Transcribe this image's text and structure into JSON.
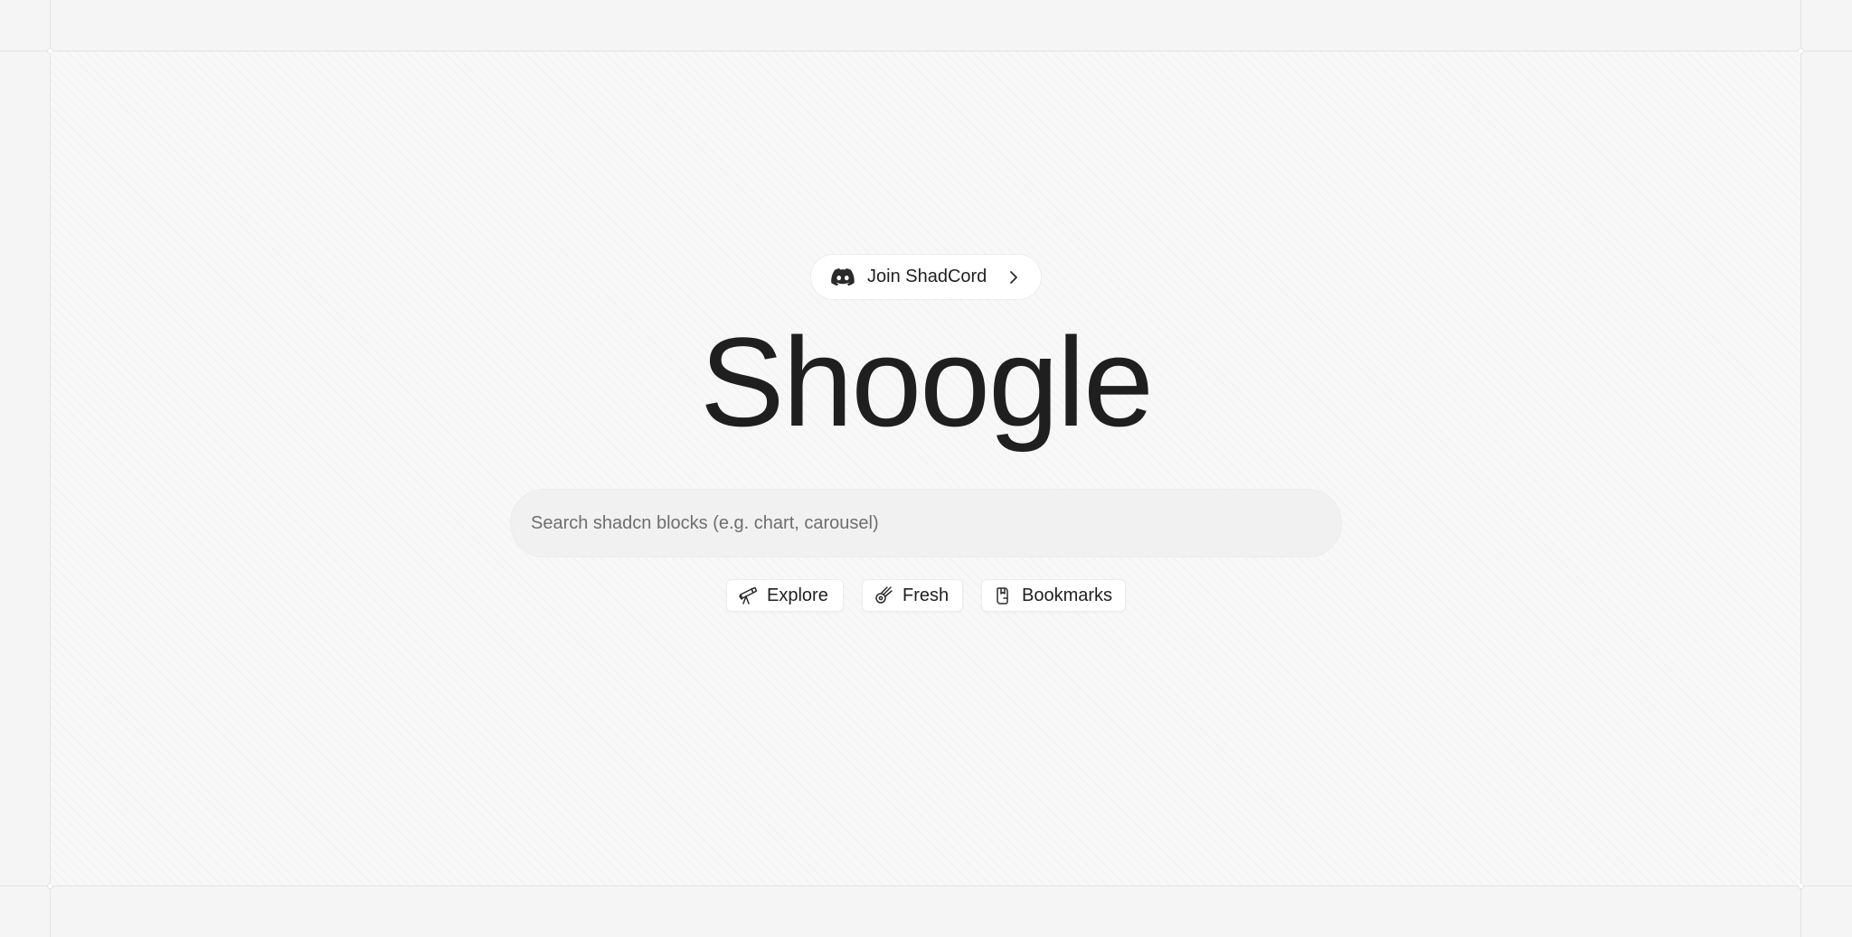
{
  "discord": {
    "label": "Join ShadCord",
    "icon": "discord-icon",
    "arrow_icon": "chevron-right-icon"
  },
  "brand": {
    "title": "Shoogle"
  },
  "search": {
    "placeholder": "Search shadcn blocks (e.g. chart, carousel)",
    "value": ""
  },
  "quick_links": [
    {
      "label": "Explore",
      "icon": "telescope-icon"
    },
    {
      "label": "Fresh",
      "icon": "fresh-sparkle-icon"
    },
    {
      "label": "Bookmarks",
      "icon": "bookmark-icon"
    }
  ],
  "colors": {
    "text": "#1f1f1f",
    "background": "#f5f5f5",
    "search_bg": "#f1f1f1",
    "chip_bg": "#ffffff"
  }
}
